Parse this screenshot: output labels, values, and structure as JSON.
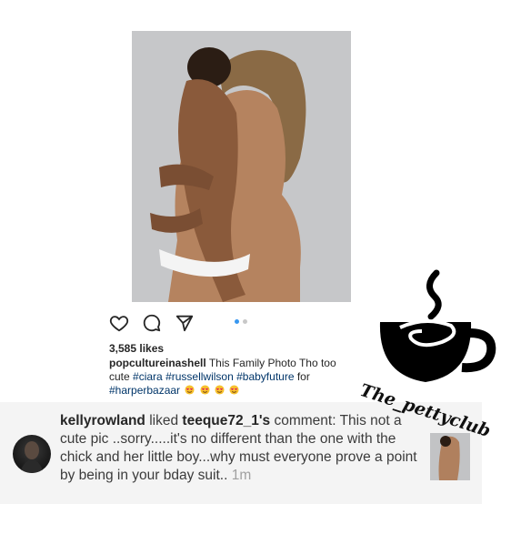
{
  "post": {
    "likes": "3,585 likes",
    "caption_user": "popcultureinashell",
    "caption_text": "This Family Photo Tho too cute",
    "hashtags": [
      "#ciara",
      "#russellwilson",
      "#babyfuture",
      "#harperbazaar"
    ],
    "caption_after": "for",
    "emoji": "heart-eyes-emoji",
    "emoji_count": 4,
    "carousel": {
      "total": 2,
      "active": 1
    }
  },
  "icons": {
    "like": "heart-icon",
    "comment": "comment-bubble-icon",
    "share": "paper-plane-icon"
  },
  "notification": {
    "user": "kellyrowland",
    "action": "liked",
    "target_user": "teeque72_1's",
    "target_word": "comment:",
    "comment": "This not a cute pic ..sorry.....it's no different than the one with the chick and her little boy...why must everyone prove a point by being in your bday suit..",
    "time": "1m"
  },
  "watermark": {
    "text": "The_pettyclub",
    "icon": "coffee-cup-icon"
  },
  "colors": {
    "hashtag": "#003569",
    "carousel_active": "#3897f0",
    "notification_bg": "#f4f4f4"
  }
}
